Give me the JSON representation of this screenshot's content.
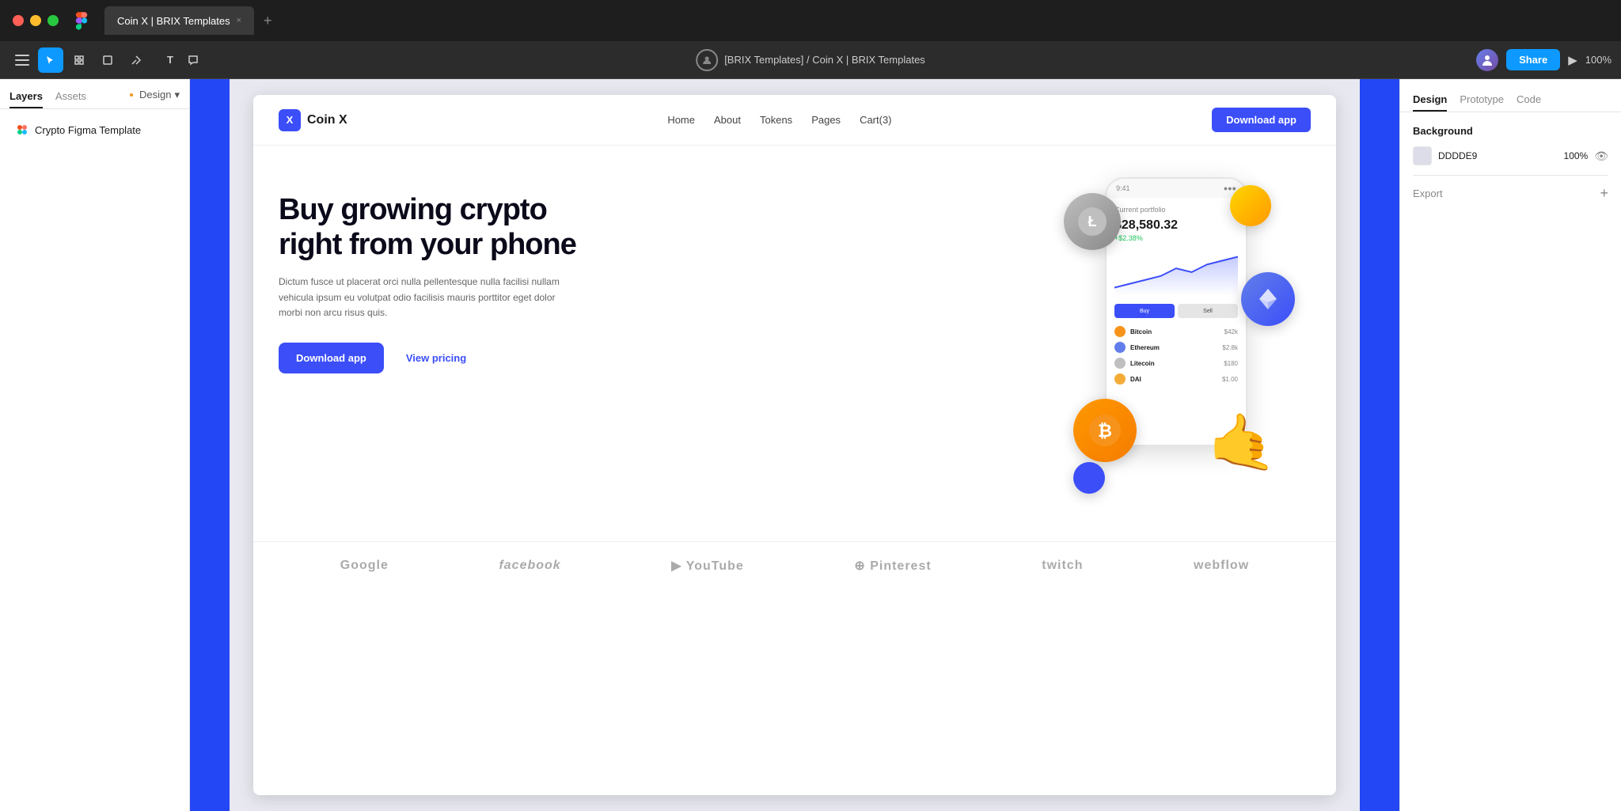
{
  "browser": {
    "tab_title": "Coin X | BRIX Templates",
    "tab_plus": "+",
    "tab_close": "×"
  },
  "toolbar": {
    "breadcrumb": "[BRIX Templates] / Coin X | BRIX Templates",
    "share_label": "Share",
    "zoom": "100%",
    "hamburger_label": "Menu"
  },
  "left_sidebar": {
    "tabs": [
      "Layers",
      "Assets"
    ],
    "design_tab": "Design",
    "layer_item": "Crypto Figma Template"
  },
  "site": {
    "logo_text": "Coin X",
    "logo_letter": "X",
    "nav_links": [
      "Home",
      "About",
      "Tokens",
      "Pages",
      "Cart(3)"
    ],
    "nav_download": "Download app",
    "hero_title": "Buy growing crypto right from your phone",
    "hero_desc": "Dictum fusce ut placerat orci nulla pellentesque nulla facilisi nullam vehicula ipsum eu volutpat odio facilisis mauris porttitor eget dolor morbi non arcu risus quis.",
    "btn_download": "Download app",
    "btn_pricing": "View pricing",
    "portfolio_label": "Current portfolio",
    "portfolio_value": "$28,580.32",
    "portfolio_change": "+$2.38%",
    "coin_list": [
      {
        "name": "Bitcoin",
        "color": "#f7931a"
      },
      {
        "name": "Ethereum",
        "color": "#627eea"
      },
      {
        "name": "Litecoin",
        "color": "#bfbfbf"
      },
      {
        "name": "DAI",
        "color": "#f5ac37"
      }
    ],
    "logos": [
      "Google",
      "facebook",
      "▶ YouTube",
      "⊕ Pinterest",
      "twitch",
      "webflow"
    ]
  },
  "right_panel": {
    "tabs": [
      "Design",
      "Prototype",
      "Code"
    ],
    "background_label": "Background",
    "bg_color_hex": "DDDDE9",
    "bg_opacity": "100%",
    "export_label": "Export",
    "export_plus": "+"
  }
}
